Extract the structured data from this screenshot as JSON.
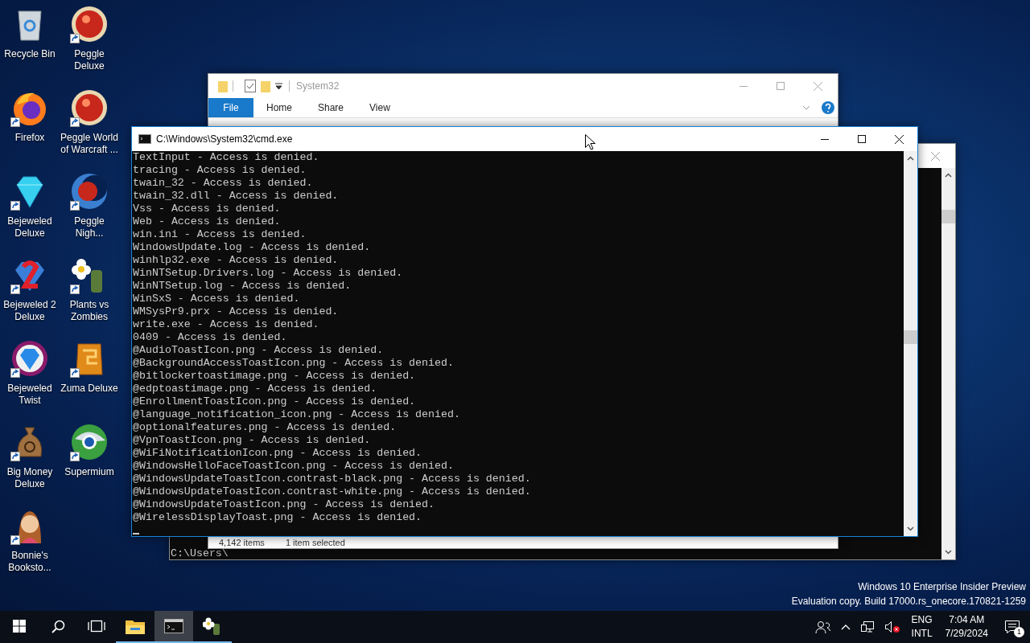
{
  "desktop_icons": [
    {
      "label": "Recycle Bin",
      "kind": "bin",
      "shortcut": false
    },
    {
      "label": "Peggle Deluxe",
      "kind": "ball",
      "shortcut": true
    },
    {
      "label": "Firefox",
      "kind": "browser",
      "shortcut": true
    },
    {
      "label": "Peggle World of Warcraft ...",
      "kind": "ball",
      "shortcut": true
    },
    {
      "label": "Bejeweled Deluxe",
      "kind": "gem",
      "shortcut": true
    },
    {
      "label": "Peggle Nigh...",
      "kind": "moonball",
      "shortcut": true
    },
    {
      "label": "Bejeweled 2 Deluxe",
      "kind": "gem2",
      "shortcut": true
    },
    {
      "label": "Plants vs Zombies",
      "kind": "flower",
      "shortcut": true
    },
    {
      "label": "Bejeweled Twist",
      "kind": "twist",
      "shortcut": true
    },
    {
      "label": "Zuma Deluxe",
      "kind": "block",
      "shortcut": true
    },
    {
      "label": "Big Money Deluxe",
      "kind": "bag",
      "shortcut": true
    },
    {
      "label": "Supermium",
      "kind": "globe",
      "shortcut": true
    },
    {
      "label": "Bonnie's Booksto...",
      "kind": "person",
      "shortcut": true
    }
  ],
  "explorer": {
    "title": "System32",
    "ribbon_tabs": [
      {
        "label": "File",
        "selected": true
      },
      {
        "label": "Home",
        "selected": false
      },
      {
        "label": "Share",
        "selected": false
      },
      {
        "label": "View",
        "selected": false
      }
    ],
    "item_count": "4,142 items",
    "selection": "1 item selected"
  },
  "back_console": {
    "lines": [
      "C:\\Users\\"
    ]
  },
  "console": {
    "title": "C:\\Windows\\System32\\cmd.exe",
    "lines": [
      "TextInput - Access is denied.",
      "tracing - Access is denied.",
      "twain_32 - Access is denied.",
      "twain_32.dll - Access is denied.",
      "Vss - Access is denied.",
      "Web - Access is denied.",
      "win.ini - Access is denied.",
      "WindowsUpdate.log - Access is denied.",
      "winhlp32.exe - Access is denied.",
      "WinNTSetup.Drivers.log - Access is denied.",
      "WinNTSetup.log - Access is denied.",
      "WinSxS - Access is denied.",
      "WMSysPr9.prx - Access is denied.",
      "write.exe - Access is denied.",
      "0409 - Access is denied.",
      "@AudioToastIcon.png - Access is denied.",
      "@BackgroundAccessToastIcon.png - Access is denied.",
      "@bitlockertoastimage.png - Access is denied.",
      "@edptoastimage.png - Access is denied.",
      "@EnrollmentToastIcon.png - Access is denied.",
      "@language_notification_icon.png - Access is denied.",
      "@optionalfeatures.png - Access is denied.",
      "@VpnToastIcon.png - Access is denied.",
      "@WiFiNotificationIcon.png - Access is denied.",
      "@WindowsHelloFaceToastIcon.png - Access is denied.",
      "@WindowsUpdateToastIcon.contrast-black.png - Access is denied.",
      "@WindowsUpdateToastIcon.contrast-white.png - Access is denied.",
      "@WindowsUpdateToastIcon.png - Access is denied.",
      "@WirelessDisplayToast.png - Access is denied."
    ]
  },
  "os_notice": [
    "Windows 10 Enterprise Insider Preview",
    "Evaluation copy. Build 17000.rs_onecore.170821-1259"
  ],
  "taskbar": {
    "apps": [
      {
        "kind": "explorer",
        "selected": false
      },
      {
        "kind": "console",
        "selected": true
      },
      {
        "kind": "flower",
        "selected": false
      }
    ],
    "volume_muted": true,
    "language": [
      "ENG",
      "INTL"
    ],
    "time": "7:04 AM",
    "date": "7/29/2024",
    "notifications": "1"
  }
}
